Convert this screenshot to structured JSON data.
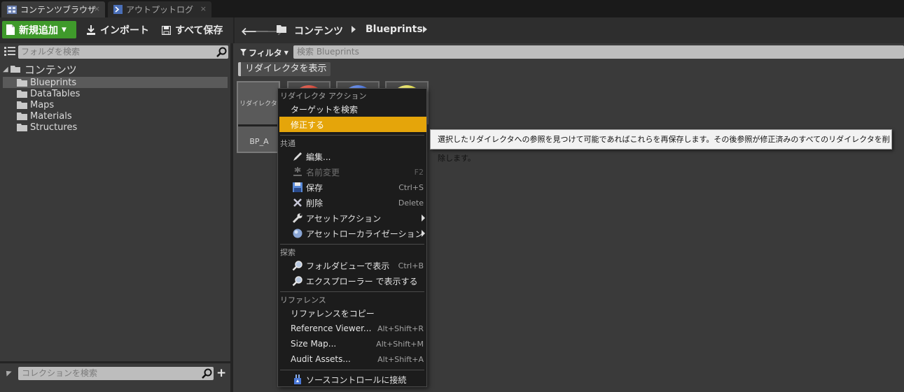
{
  "tabs": [
    {
      "label": "コンテンツブラウザ",
      "close": "×",
      "icon": "content-browser-icon"
    },
    {
      "label": "アウトプットログ",
      "close": "×",
      "icon": "output-log-icon"
    }
  ],
  "toolbar": {
    "add_new": "新規追加",
    "import": "インポート",
    "save_all": "すべて保存"
  },
  "path": {
    "crumbs": [
      "コンテンツ",
      "Blueprints"
    ]
  },
  "folder_panel": {
    "search_placeholder": "フォルダを検索",
    "root": "コンテンツ",
    "items": [
      "Blueprints",
      "DataTables",
      "Maps",
      "Materials",
      "Structures"
    ],
    "selected": "Blueprints"
  },
  "collections": {
    "search_placeholder": "コレクションを検索",
    "add": "+"
  },
  "filter": {
    "label": "フィルタ",
    "search_placeholder": "検索 Blueprints",
    "chip": "リダイレクタを表示"
  },
  "assets": [
    {
      "name": "BP_A",
      "thumb_text": "リダイレクタ"
    }
  ],
  "asset_colors": {
    "red": "#d33a2c",
    "blue": "#3a6be0",
    "yellow": "#e8e23a"
  },
  "context_menu": {
    "sections": [
      {
        "title": "リダイレクタ アクション",
        "items": [
          {
            "label": "ターゲットを検索"
          },
          {
            "label": "修正する",
            "highlighted": true
          }
        ]
      },
      {
        "title": "共通",
        "items": [
          {
            "label": "編集...",
            "icon": "edit-icon"
          },
          {
            "label": "名前変更",
            "shortcut": "F2",
            "icon": "rename-icon",
            "disabled": true
          },
          {
            "label": "保存",
            "shortcut": "Ctrl+S",
            "icon": "save-icon"
          },
          {
            "label": "削除",
            "shortcut": "Delete",
            "icon": "delete-icon"
          },
          {
            "label": "アセットアクション",
            "icon": "wrench-icon",
            "submenu": true
          },
          {
            "label": "アセットローカライゼーション",
            "icon": "globe-icon",
            "submenu": true
          }
        ]
      },
      {
        "title": "探索",
        "items": [
          {
            "label": "フォルダビューで表示",
            "shortcut": "Ctrl+B",
            "icon": "magnifier-icon"
          },
          {
            "label": "エクスプローラー で表示する",
            "icon": "magnifier-icon"
          }
        ]
      },
      {
        "title": "リファレンス",
        "items": [
          {
            "label": "リファレンスをコピー"
          },
          {
            "label": "Reference Viewer...",
            "shortcut": "Alt+Shift+R"
          },
          {
            "label": "Size Map...",
            "shortcut": "Alt+Shift+M"
          },
          {
            "label": "Audit Assets...",
            "shortcut": "Alt+Shift+A"
          }
        ]
      },
      {
        "title": "",
        "items": [
          {
            "label": "ソースコントロールに接続",
            "icon": "source-control-icon"
          }
        ]
      }
    ]
  },
  "tooltip": "選択したリダイレクタへの参照を見つけて可能であればこれらを再保存します。その後参照が修正済みのすべてのリダイレクタを削除します。",
  "colors": {
    "accent_green": "#3f9a2b",
    "highlight": "#e5a50a"
  }
}
